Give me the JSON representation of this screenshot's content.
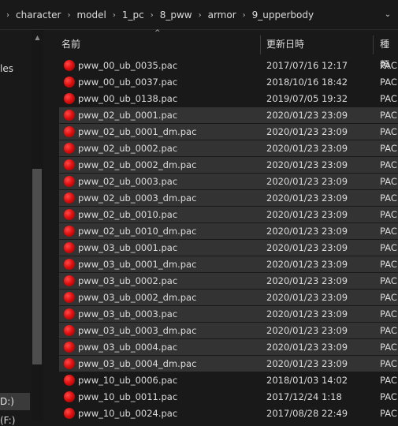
{
  "breadcrumbs": [
    "character",
    "model",
    "1_pc",
    "8_pww",
    "armor",
    "9_upperbody"
  ],
  "breadcrumb_separator": "›",
  "nav": {
    "partial_item_1": "les",
    "partial_item_2": "D:)",
    "partial_item_3": "(F:)"
  },
  "columns": {
    "name": "名前",
    "date": "更新日時",
    "type": "種類"
  },
  "files": [
    {
      "name": "pww_00_ub_0035.pac",
      "date": "2017/07/16 12:17",
      "type": "PAC",
      "selected": false
    },
    {
      "name": "pww_00_ub_0037.pac",
      "date": "2018/10/16 18:42",
      "type": "PAC",
      "selected": false
    },
    {
      "name": "pww_00_ub_0138.pac",
      "date": "2019/07/05 19:32",
      "type": "PAC",
      "selected": false
    },
    {
      "name": "pww_02_ub_0001.pac",
      "date": "2020/01/23 23:09",
      "type": "PAC",
      "selected": true
    },
    {
      "name": "pww_02_ub_0001_dm.pac",
      "date": "2020/01/23 23:09",
      "type": "PAC",
      "selected": true
    },
    {
      "name": "pww_02_ub_0002.pac",
      "date": "2020/01/23 23:09",
      "type": "PAC",
      "selected": true
    },
    {
      "name": "pww_02_ub_0002_dm.pac",
      "date": "2020/01/23 23:09",
      "type": "PAC",
      "selected": true
    },
    {
      "name": "pww_02_ub_0003.pac",
      "date": "2020/01/23 23:09",
      "type": "PAC",
      "selected": true
    },
    {
      "name": "pww_02_ub_0003_dm.pac",
      "date": "2020/01/23 23:09",
      "type": "PAC",
      "selected": true
    },
    {
      "name": "pww_02_ub_0010.pac",
      "date": "2020/01/23 23:09",
      "type": "PAC",
      "selected": true
    },
    {
      "name": "pww_02_ub_0010_dm.pac",
      "date": "2020/01/23 23:09",
      "type": "PAC",
      "selected": true
    },
    {
      "name": "pww_03_ub_0001.pac",
      "date": "2020/01/23 23:09",
      "type": "PAC",
      "selected": true
    },
    {
      "name": "pww_03_ub_0001_dm.pac",
      "date": "2020/01/23 23:09",
      "type": "PAC",
      "selected": true
    },
    {
      "name": "pww_03_ub_0002.pac",
      "date": "2020/01/23 23:09",
      "type": "PAC",
      "selected": true
    },
    {
      "name": "pww_03_ub_0002_dm.pac",
      "date": "2020/01/23 23:09",
      "type": "PAC",
      "selected": true
    },
    {
      "name": "pww_03_ub_0003.pac",
      "date": "2020/01/23 23:09",
      "type": "PAC",
      "selected": true
    },
    {
      "name": "pww_03_ub_0003_dm.pac",
      "date": "2020/01/23 23:09",
      "type": "PAC",
      "selected": true
    },
    {
      "name": "pww_03_ub_0004.pac",
      "date": "2020/01/23 23:09",
      "type": "PAC",
      "selected": true
    },
    {
      "name": "pww_03_ub_0004_dm.pac",
      "date": "2020/01/23 23:09",
      "type": "PAC",
      "selected": true
    },
    {
      "name": "pww_10_ub_0006.pac",
      "date": "2018/01/03 14:02",
      "type": "PAC",
      "selected": false
    },
    {
      "name": "pww_10_ub_0011.pac",
      "date": "2017/12/24 1:18",
      "type": "PAC",
      "selected": false
    },
    {
      "name": "pww_10_ub_0024.pac",
      "date": "2017/08/28 22:49",
      "type": "PAC",
      "selected": false
    }
  ],
  "icons": {
    "file": "red-sphere-file-icon",
    "sort": "sort-ascending-icon",
    "dropdown": "chevron-down-icon"
  }
}
